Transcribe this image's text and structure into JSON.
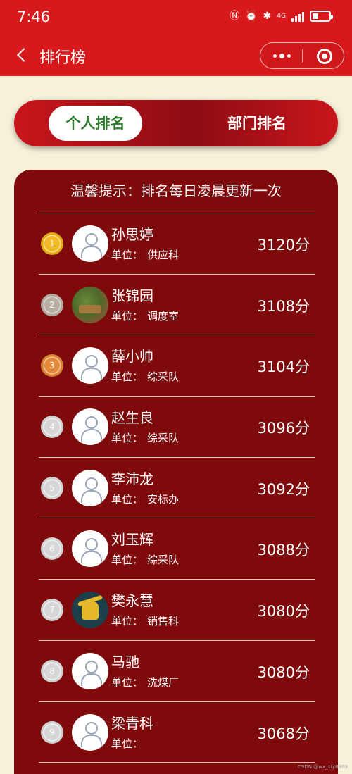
{
  "status": {
    "time": "7:46",
    "network": "4G"
  },
  "nav": {
    "title": "排行榜"
  },
  "tabs": [
    {
      "label": "个人排名",
      "active": true
    },
    {
      "label": "部门排名",
      "active": false
    }
  ],
  "tip": "温馨提示：排名每日凌晨更新一次",
  "dept_prefix": "单位：",
  "rankings": [
    {
      "rank": "1",
      "name": "孙思婷",
      "dept": "供应科",
      "score": "3120分"
    },
    {
      "rank": "2",
      "name": "张锦园",
      "dept": "调度室",
      "score": "3108分"
    },
    {
      "rank": "3",
      "name": "薛小帅",
      "dept": "综采队",
      "score": "3104分"
    },
    {
      "rank": "4",
      "name": "赵生良",
      "dept": "综采队",
      "score": "3096分"
    },
    {
      "rank": "5",
      "name": "李沛龙",
      "dept": "安标办",
      "score": "3092分"
    },
    {
      "rank": "6",
      "name": "刘玉辉",
      "dept": "综采队",
      "score": "3088分"
    },
    {
      "rank": "7",
      "name": "樊永慧",
      "dept": "销售科",
      "score": "3080分"
    },
    {
      "rank": "8",
      "name": "马驰",
      "dept": "洗煤厂",
      "score": "3080分"
    },
    {
      "rank": "9",
      "name": "梁青科",
      "dept": "",
      "score": "3068分"
    }
  ],
  "colors": {
    "header": "#d7191b",
    "panel": "#7e0a0c",
    "background": "#f6f1d9",
    "active_tab_text": "#2e7d2e"
  },
  "watermark": "CSDN @wx_xfy8369"
}
